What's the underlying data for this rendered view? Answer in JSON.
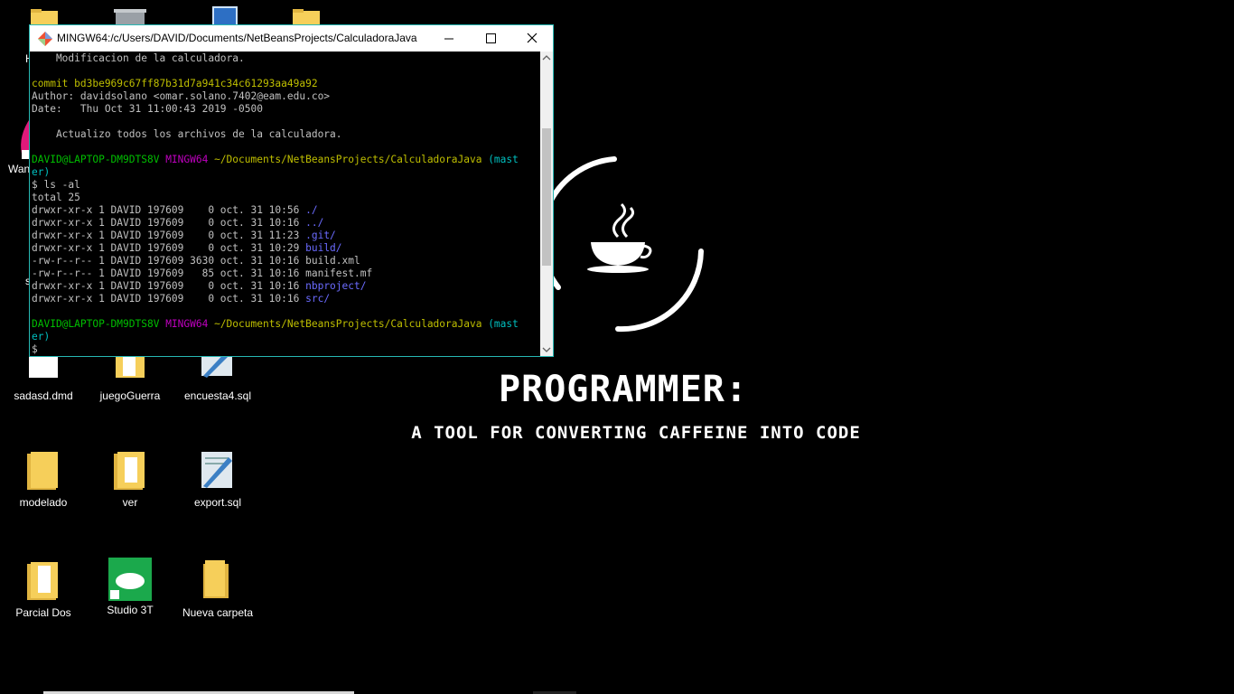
{
  "wallpaper": {
    "title": "PROGRAMMER:",
    "subtitle": "A TOOL FOR CONVERTING CAFFEINE INTO CODE"
  },
  "desktop": {
    "icons": [
      {
        "label": "sadasd.dmd",
        "icon": "file-icon"
      },
      {
        "label": "juegoGuerra",
        "icon": "folder-icon"
      },
      {
        "label": "encuesta4.sql",
        "icon": "sql-file-icon"
      },
      {
        "label": "modelado",
        "icon": "folder-icon"
      },
      {
        "label": "ver",
        "icon": "folder-icon"
      },
      {
        "label": "export.sql",
        "icon": "sql-file-icon"
      },
      {
        "label": "Parcial Dos",
        "icon": "folder-icon"
      },
      {
        "label": "Studio 3T",
        "icon": "studio3t-icon"
      },
      {
        "label": "Nueva carpeta",
        "icon": "folder-icon"
      }
    ],
    "partial_labels": {
      "wan": "Wan",
      "h": "H",
      "s": "s"
    }
  },
  "terminal": {
    "title": "MINGW64:/c/Users/DAVID/Documents/NetBeansProjects/CalculadoraJava",
    "lines": [
      [
        {
          "t": "    Modificacion de la calculadora.",
          "c": ""
        }
      ],
      [
        {
          "t": "",
          "c": ""
        }
      ],
      [
        {
          "t": "commit bd3be969c67ff87b31d7a941c34c61293aa49a92",
          "c": "c-yellow"
        }
      ],
      [
        {
          "t": "Author: davidsolano <omar.solano.7402@eam.edu.co>",
          "c": ""
        }
      ],
      [
        {
          "t": "Date:   Thu Oct 31 11:00:43 2019 -0500",
          "c": ""
        }
      ],
      [
        {
          "t": "",
          "c": ""
        }
      ],
      [
        {
          "t": "    Actualizo todos los archivos de la calculadora.",
          "c": ""
        }
      ],
      [
        {
          "t": "",
          "c": ""
        }
      ],
      [
        {
          "t": "DAVID@LAPTOP-DM9DTS8V ",
          "c": "c-green"
        },
        {
          "t": "MINGW64 ",
          "c": "c-magenta"
        },
        {
          "t": "~/Documents/NetBeansProjects/CalculadoraJava ",
          "c": "c-olive"
        },
        {
          "t": "(mast",
          "c": "c-cyan"
        }
      ],
      [
        {
          "t": "er)",
          "c": "c-cyan"
        }
      ],
      [
        {
          "t": "$ ls -al",
          "c": ""
        }
      ],
      [
        {
          "t": "total 25",
          "c": ""
        }
      ],
      [
        {
          "t": "drwxr-xr-x 1 DAVID 197609    0 oct. 31 10:56 ",
          "c": ""
        },
        {
          "t": "./",
          "c": "c-blue"
        }
      ],
      [
        {
          "t": "drwxr-xr-x 1 DAVID 197609    0 oct. 31 10:16 ",
          "c": ""
        },
        {
          "t": "../",
          "c": "c-blue"
        }
      ],
      [
        {
          "t": "drwxr-xr-x 1 DAVID 197609    0 oct. 31 11:23 ",
          "c": ""
        },
        {
          "t": ".git/",
          "c": "c-blue"
        }
      ],
      [
        {
          "t": "drwxr-xr-x 1 DAVID 197609    0 oct. 31 10:29 ",
          "c": ""
        },
        {
          "t": "build/",
          "c": "c-blue"
        }
      ],
      [
        {
          "t": "-rw-r--r-- 1 DAVID 197609 3630 oct. 31 10:16 build.xml",
          "c": ""
        }
      ],
      [
        {
          "t": "-rw-r--r-- 1 DAVID 197609   85 oct. 31 10:16 manifest.mf",
          "c": ""
        }
      ],
      [
        {
          "t": "drwxr-xr-x 1 DAVID 197609    0 oct. 31 10:16 ",
          "c": ""
        },
        {
          "t": "nbproject/",
          "c": "c-blue"
        }
      ],
      [
        {
          "t": "drwxr-xr-x 1 DAVID 197609    0 oct. 31 10:16 ",
          "c": ""
        },
        {
          "t": "src/",
          "c": "c-blue"
        }
      ],
      [
        {
          "t": "",
          "c": ""
        }
      ],
      [
        {
          "t": "DAVID@LAPTOP-DM9DTS8V ",
          "c": "c-green"
        },
        {
          "t": "MINGW64 ",
          "c": "c-magenta"
        },
        {
          "t": "~/Documents/NetBeansProjects/CalculadoraJava ",
          "c": "c-olive"
        },
        {
          "t": "(mast",
          "c": "c-cyan"
        }
      ],
      [
        {
          "t": "er)",
          "c": "c-cyan"
        }
      ],
      [
        {
          "t": "$ ",
          "c": ""
        }
      ]
    ],
    "scroll_position": 0.45
  },
  "colors": {
    "window_border": "#27b8b4",
    "folder": "#f6cf5a",
    "studio3t": "#1ba94c"
  }
}
